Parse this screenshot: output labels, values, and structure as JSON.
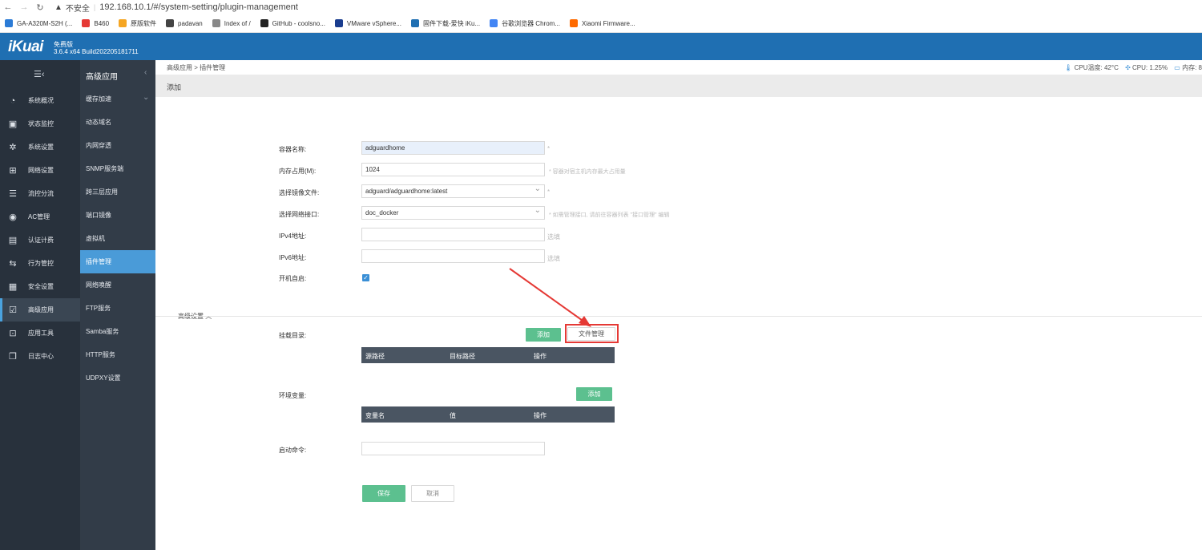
{
  "browser": {
    "security_label": "不安全",
    "url": "192.168.10.1/#/system-setting/plugin-management",
    "bookmarks": [
      {
        "label": "GA-A320M-S2H (...",
        "color": "#2b7bd6"
      },
      {
        "label": "B460",
        "color": "#e53935"
      },
      {
        "label": "原版软件",
        "color": "#f5a623"
      },
      {
        "label": "padavan",
        "color": "#444444"
      },
      {
        "label": "Index of /",
        "color": "#888888"
      },
      {
        "label": "GitHub - coolsno...",
        "color": "#222222"
      },
      {
        "label": "VMware vSphere...",
        "color": "#1a3d8f"
      },
      {
        "label": "固件下载-爱快 iKu...",
        "color": "#1f6fb2"
      },
      {
        "label": "谷歌浏览器 Chrom...",
        "color": "#4285f4"
      },
      {
        "label": "Xiaomi Firmware...",
        "color": "#ff6a00"
      }
    ]
  },
  "header": {
    "logo": "iKuai",
    "edition": "免费版",
    "version": "3.6.4 x64 Build202205181711"
  },
  "sidebar": {
    "items": [
      {
        "label": "系统概况",
        "icon": "gauge-icon",
        "glyph": "◔"
      },
      {
        "label": "状态监控",
        "icon": "monitor-icon",
        "glyph": "▣"
      },
      {
        "label": "系统设置",
        "icon": "gear-icon",
        "glyph": "✲"
      },
      {
        "label": "网络设置",
        "icon": "network-icon",
        "glyph": "⊞"
      },
      {
        "label": "流控分流",
        "icon": "sliders-icon",
        "glyph": "☰"
      },
      {
        "label": "AC管理",
        "icon": "router-icon",
        "glyph": "◉"
      },
      {
        "label": "认证计费",
        "icon": "id-card-icon",
        "glyph": "▤"
      },
      {
        "label": "行为管控",
        "icon": "arrows-icon",
        "glyph": "⇆"
      },
      {
        "label": "安全设置",
        "icon": "firewall-icon",
        "glyph": "▦"
      },
      {
        "label": "高级应用",
        "icon": "apps-icon",
        "glyph": "☑"
      },
      {
        "label": "应用工具",
        "icon": "tools-icon",
        "glyph": "⊡"
      },
      {
        "label": "日志中心",
        "icon": "log-icon",
        "glyph": "❐"
      }
    ],
    "active_index": 9
  },
  "subnav": {
    "title": "高级应用",
    "items": [
      "缓存加速",
      "动态域名",
      "内网穿透",
      "SNMP服务端",
      "跨三层应用",
      "端口镜像",
      "虚拟机",
      "插件管理",
      "网络唤醒",
      "FTP服务",
      "Samba服务",
      "HTTP服务",
      "UDPXY设置"
    ],
    "active_index": 7
  },
  "topbar": {
    "breadcrumb": "高级应用 > 插件管理",
    "cpu_temp": "CPU温度: 42°C",
    "cpu": "CPU: 1.25%",
    "memory": "内存: 8"
  },
  "tab": {
    "label": "添加"
  },
  "form": {
    "container_name": {
      "label": "容器名称:",
      "value": "adguardhome",
      "required": "*"
    },
    "memory": {
      "label": "内存占用(M):",
      "value": "1024",
      "hint": "* 容器对宿主机内存最大占用量"
    },
    "image": {
      "label": "选择镜像文件:",
      "value": "adguard/adguardhome:latest",
      "required": "*"
    },
    "interface": {
      "label": "选择网络接口:",
      "value": "doc_docker",
      "hint": "* 如需管理接口, 请前往容器列表 \"接口管理\" 编辑"
    },
    "ipv4": {
      "label": "IPv4地址:",
      "value": "",
      "note": "选填"
    },
    "ipv6": {
      "label": "IPv6地址:",
      "value": "",
      "note": "选填"
    },
    "autostart": {
      "label": "开机自启:",
      "checked": true
    },
    "advanced_label": "高级设置",
    "mount": {
      "label": "挂载目录:",
      "add_button": "添加",
      "file_button": "文件管理",
      "columns": [
        "源路径",
        "目标路径",
        "操作"
      ]
    },
    "env": {
      "label": "环境变量:",
      "add_button": "添加",
      "columns": [
        "变量名",
        "值",
        "操作"
      ]
    },
    "command": {
      "label": "启动命令:",
      "value": ""
    },
    "save_button": "保存",
    "cancel_button": "取消"
  },
  "colors": {
    "header_blue": "#1f6fb2",
    "sidebar_dark": "#28313c",
    "subnav_dark": "#323c48",
    "active_blue": "#4a9bd8",
    "button_green": "#5cc08f",
    "highlight_red": "#e53935"
  }
}
